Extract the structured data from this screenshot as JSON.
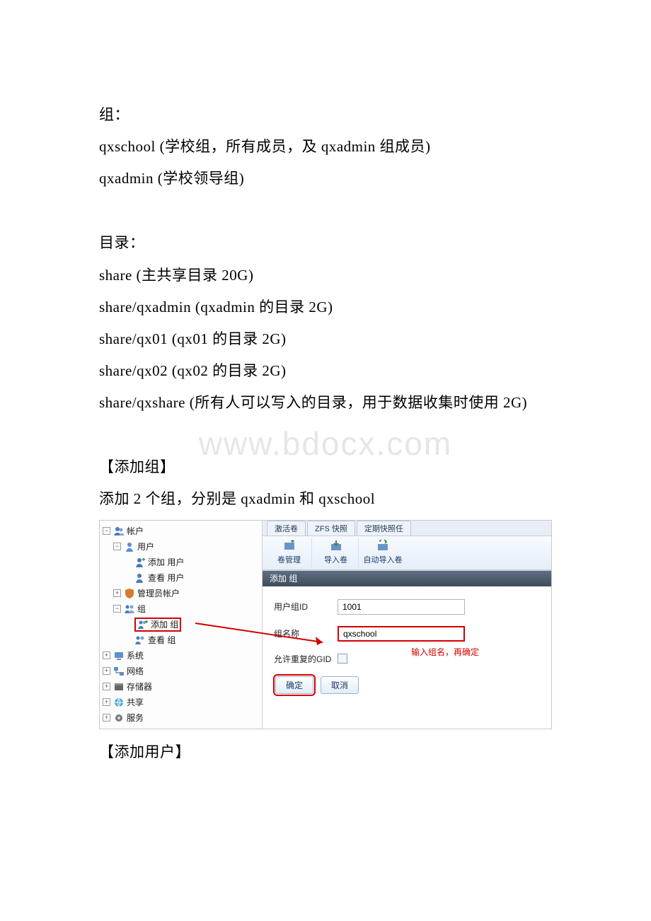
{
  "watermark": "www.bdocx.com",
  "doc": {
    "groups_heading": "组：",
    "group1": "qxschool (学校组，所有成员，及 qxadmin 组成员)",
    "group2": "qxadmin (学校领导组)",
    "dirs_heading": "目录：",
    "dir1": "share (主共享目录 20G)",
    "dir2": "share/qxadmin (qxadmin 的目录 2G)",
    "dir3": "share/qx01 (qx01 的目录 2G)",
    "dir4": "share/qx02 (qx02 的目录 2G)",
    "dir5": "share/qxshare (所有人可以写入的目录，用于数据收集时使用 2G)",
    "section_add_group": "【添加组】",
    "add_group_desc": "添加 2 个组，分别是 qxadmin 和 qxschool",
    "section_add_user": "【添加用户】"
  },
  "screenshot": {
    "tree": {
      "accounts": "帐户",
      "users": "用户",
      "add_user": "添加 用户",
      "view_user": "查看 用户",
      "admin_accounts": "管理员帐户",
      "groups": "组",
      "add_group": "添加 组",
      "view_group": "查看 组",
      "system": "系统",
      "network": "网络",
      "storage": "存储器",
      "sharing": "共享",
      "services": "服务"
    },
    "tabs": {
      "tab1": "激活卷",
      "tab2": "ZFS 快照",
      "tab3": "定期快照任"
    },
    "toolbar": {
      "vol_manage": "卷管理",
      "import_vol": "导入卷",
      "auto_import": "自动导入卷"
    },
    "dialog": {
      "title": "添加 组",
      "gid_label": "用户组ID",
      "gid_value": "1001",
      "name_label": "组名称",
      "name_value": "qxschool",
      "dup_label": "允许重复的GID",
      "ok": "确定",
      "cancel": "取消",
      "annotation": "输入组名，再确定"
    }
  }
}
